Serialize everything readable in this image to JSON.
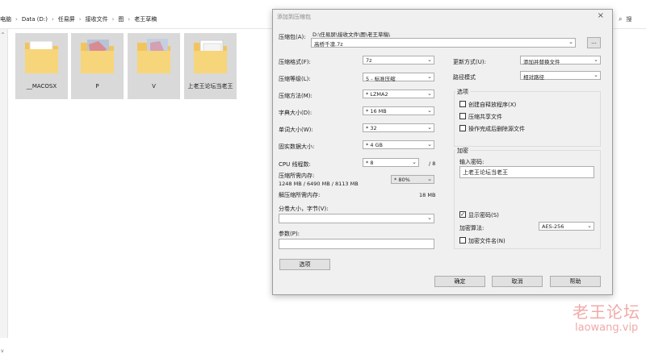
{
  "explorer": {
    "breadcrumb": [
      "电脑",
      "Data (D:)",
      "任易屏",
      "接收文件",
      "图",
      "老王草稿"
    ],
    "search_icon": "search-icon",
    "search_text": "搜",
    "folders": [
      {
        "name": "__MACOSX",
        "state": "dim"
      },
      {
        "name": "P",
        "state": "dim"
      },
      {
        "name": "V",
        "state": "dim"
      },
      {
        "name": "上老王论坛当老王",
        "state": "dim"
      }
    ]
  },
  "dialog": {
    "title": "添加到压缩包",
    "close": "×",
    "archive_label": "压缩包(A):",
    "archive_path": "D:\\任易屏\\接收文件\\图\\老王草稿\\",
    "archive_name": "高桥千凛.7z",
    "browse_label": "...",
    "format_label": "压缩格式(F):",
    "format_value": "7z",
    "level_label": "压缩等级(L):",
    "level_value": "5 - 标准压缩",
    "method_label": "压缩方法(M):",
    "method_value": "* LZMA2",
    "dict_label": "字典大小(D):",
    "dict_value": "* 16 MB",
    "word_label": "单词大小(W):",
    "word_value": "* 32",
    "solid_label": "固实数据大小:",
    "solid_value": "* 4 GB",
    "cpu_label": "CPU 线程数:",
    "cpu_value": "* 8",
    "cpu_max": "/ 8",
    "mem_label": "压缩所需内存:",
    "mem_detail": "1248 MB / 6490 MB / 8113 MB",
    "mem_pct": "* 80%",
    "decomp_label": "解压缩所需内存:",
    "decomp_value": "18 MB",
    "split_label": "分卷大小，字节(V):",
    "split_value": "",
    "params_label": "参数(P):",
    "params_value": "",
    "options_btn": "选项",
    "update_label": "更新方式(U):",
    "update_value": "添加并替换文件",
    "path_label": "路径模式",
    "path_value": "相对路径",
    "options_group": "选项",
    "opt_sfx": "创建自释放程序(X)",
    "opt_shared": "压缩共享文件",
    "opt_delete": "操作完成后删除源文件",
    "encrypt_group": "加密",
    "password_label": "输入密码:",
    "password_value": "上老王论坛当老王",
    "show_pw": "显示密码(S)",
    "show_pw_checked": "✓",
    "enc_method_label": "加密算法:",
    "enc_method_value": "AES-256",
    "enc_names": "加密文件名(N)",
    "ok_btn": "确定",
    "cancel_btn": "取消",
    "help_btn": "帮助"
  },
  "watermark": {
    "cn": "老王论坛",
    "en": "laowang.vip"
  }
}
